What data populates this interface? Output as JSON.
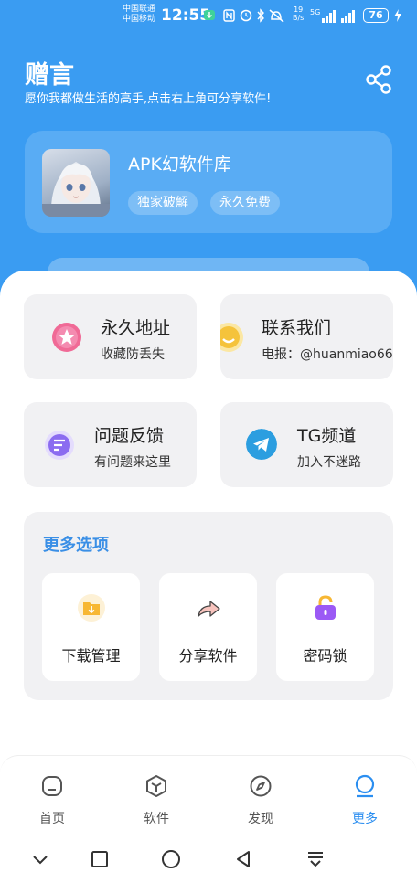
{
  "status_bar": {
    "carrier1": "中国联通",
    "carrier2": "中国移动",
    "time": "12:55",
    "speed_value": "19",
    "speed_unit": "B/s",
    "net_label": "5G",
    "battery": "76"
  },
  "header": {
    "title": "赠言",
    "subtitle": "愿你我都做生活的高手,点击右上角可分享软件!",
    "share_icon": "share-icon"
  },
  "profile": {
    "app_name": "APK幻软件库",
    "tags": [
      "独家破解",
      "永久免费"
    ]
  },
  "cards": [
    {
      "title": "永久地址",
      "subtitle": "收藏防丢失",
      "icon": "star-icon",
      "color": "#f06a96"
    },
    {
      "title": "联系我们",
      "subtitle": "电报：@huanmiao66",
      "icon": "smile-icon",
      "color": "#f5c33b"
    },
    {
      "title": "问题反馈",
      "subtitle": "有问题来这里",
      "icon": "feedback-icon",
      "color": "#8b6cf0"
    },
    {
      "title": "TG频道",
      "subtitle": "加入不迷路",
      "icon": "telegram-icon",
      "color": "#2c9ee0"
    }
  ],
  "more": {
    "title": "更多选项",
    "options": [
      {
        "label": "下载管理",
        "icon": "download-folder-icon",
        "color": "#f7b733"
      },
      {
        "label": "分享软件",
        "icon": "share-arrow-icon",
        "color": "#f28b82"
      },
      {
        "label": "密码锁",
        "icon": "lock-icon",
        "color": "#9b59f5"
      }
    ]
  },
  "tabs": [
    {
      "label": "首页",
      "icon": "home-icon",
      "active": false
    },
    {
      "label": "软件",
      "icon": "box-icon",
      "active": false
    },
    {
      "label": "发现",
      "icon": "compass-icon",
      "active": false
    },
    {
      "label": "更多",
      "icon": "more-icon",
      "active": true
    }
  ],
  "colors": {
    "accent": "#3a9cf2",
    "tab_active": "#2b8ef0",
    "more_title": "#3a8fe6"
  }
}
